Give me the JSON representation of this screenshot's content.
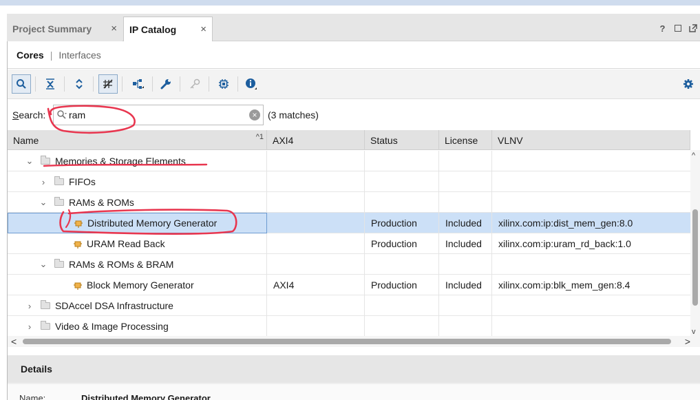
{
  "tabs": [
    {
      "label": "Project Summary",
      "active": false
    },
    {
      "label": "IP Catalog",
      "active": true
    }
  ],
  "window_controls": [
    "?",
    "restore",
    "float"
  ],
  "subtabs": {
    "cores": "Cores",
    "separator": "|",
    "interfaces": "Interfaces"
  },
  "toolbar": {
    "icons": [
      "search-icon",
      "collapse-all-icon",
      "expand-all-icon",
      "toggle-filter-icon",
      "hierarchy-icon",
      "customize-wrench-icon",
      "key-icon",
      "chip-icon",
      "info-icon",
      "settings-gear-icon"
    ]
  },
  "search": {
    "label_prefix": "S",
    "label_rest": "earch:",
    "value": "ram",
    "placeholder": "",
    "matches": "(3 matches)"
  },
  "columns": [
    {
      "label": "Name",
      "sort": "^1"
    },
    {
      "label": "AXI4"
    },
    {
      "label": "Status"
    },
    {
      "label": "License"
    },
    {
      "label": "VLNV"
    }
  ],
  "rows": [
    {
      "name": "Memories & Storage Elements",
      "type": "folder",
      "expanded": true,
      "level": 0,
      "axi4": "",
      "status": "",
      "license": "",
      "vlnv": ""
    },
    {
      "name": "FIFOs",
      "type": "folder",
      "expanded": false,
      "level": 1,
      "axi4": "",
      "status": "",
      "license": "",
      "vlnv": ""
    },
    {
      "name": "RAMs & ROMs",
      "type": "folder",
      "expanded": true,
      "level": 1,
      "axi4": "",
      "status": "",
      "license": "",
      "vlnv": ""
    },
    {
      "name": "Distributed Memory Generator",
      "type": "ip",
      "level": 2,
      "selected": true,
      "axi4": "",
      "status": "Production",
      "license": "Included",
      "vlnv": "xilinx.com:ip:dist_mem_gen:8.0"
    },
    {
      "name": "URAM Read Back",
      "type": "ip",
      "level": 2,
      "axi4": "",
      "status": "Production",
      "license": "Included",
      "vlnv": "xilinx.com:ip:uram_rd_back:1.0"
    },
    {
      "name": "RAMs & ROMs & BRAM",
      "type": "folder",
      "expanded": true,
      "level": 1,
      "axi4": "",
      "status": "",
      "license": "",
      "vlnv": ""
    },
    {
      "name": "Block Memory Generator",
      "type": "ip",
      "level": 2,
      "axi4": "AXI4",
      "status": "Production",
      "license": "Included",
      "vlnv": "xilinx.com:ip:blk_mem_gen:8.4"
    },
    {
      "name": "SDAccel DSA Infrastructure",
      "type": "folder",
      "expanded": false,
      "level": 0,
      "axi4": "",
      "status": "",
      "license": "",
      "vlnv": ""
    },
    {
      "name": "Video & Image Processing",
      "type": "folder",
      "expanded": false,
      "level": 0,
      "axi4": "",
      "status": "",
      "license": "",
      "vlnv": ""
    }
  ],
  "details": {
    "title": "Details",
    "name_label": "Name:",
    "name_value": "Distributed Memory Generator"
  },
  "colors": {
    "selection": "#cce0f7",
    "annotation": "#e8364f",
    "toolbar_icon": "#1d5e9e",
    "top_strip": "#cfdcee"
  }
}
